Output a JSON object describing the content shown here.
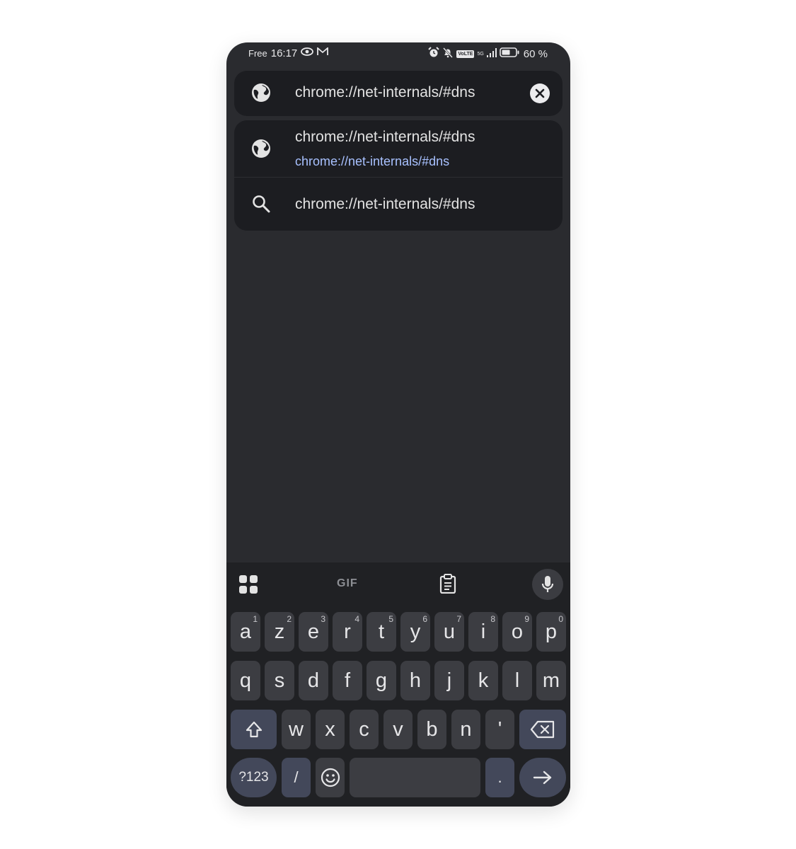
{
  "status_bar": {
    "carrier": "Free",
    "time": "16:17",
    "battery": "60 %",
    "network": "5G",
    "volte": "VoLTE"
  },
  "omnibox": {
    "value": "chrome://net-internals/#dns",
    "icon": "globe-icon",
    "clear_icon": "close-icon"
  },
  "suggestions": [
    {
      "title": "chrome://net-internals/#dns",
      "url": "chrome://net-internals/#dns",
      "icon": "globe-icon"
    },
    {
      "title": "chrome://net-internals/#dns",
      "icon": "search-icon"
    }
  ],
  "keyboard": {
    "toolbar": {
      "gif": "GIF",
      "apps_icon": "apps-grid-icon",
      "clipboard_icon": "clipboard-icon",
      "mic_icon": "mic-icon"
    },
    "row1": [
      {
        "k": "a",
        "n": "1"
      },
      {
        "k": "z",
        "n": "2"
      },
      {
        "k": "e",
        "n": "3"
      },
      {
        "k": "r",
        "n": "4"
      },
      {
        "k": "t",
        "n": "5"
      },
      {
        "k": "y",
        "n": "6"
      },
      {
        "k": "u",
        "n": "7"
      },
      {
        "k": "i",
        "n": "8"
      },
      {
        "k": "o",
        "n": "9"
      },
      {
        "k": "p",
        "n": "0"
      }
    ],
    "row2": [
      "q",
      "s",
      "d",
      "f",
      "g",
      "h",
      "j",
      "k",
      "l",
      "m"
    ],
    "row3": [
      "w",
      "x",
      "c",
      "v",
      "b",
      "n",
      "'"
    ],
    "symbols_label": "?123",
    "slash_label": "/",
    "period_label": "."
  },
  "colors": {
    "screen_bg": "#2a2b2f",
    "card_bg": "#1c1d21",
    "link": "#a8c1ff",
    "keyboard_bg": "#202124",
    "key": "#3c3d42",
    "function_key": "#43485a"
  }
}
